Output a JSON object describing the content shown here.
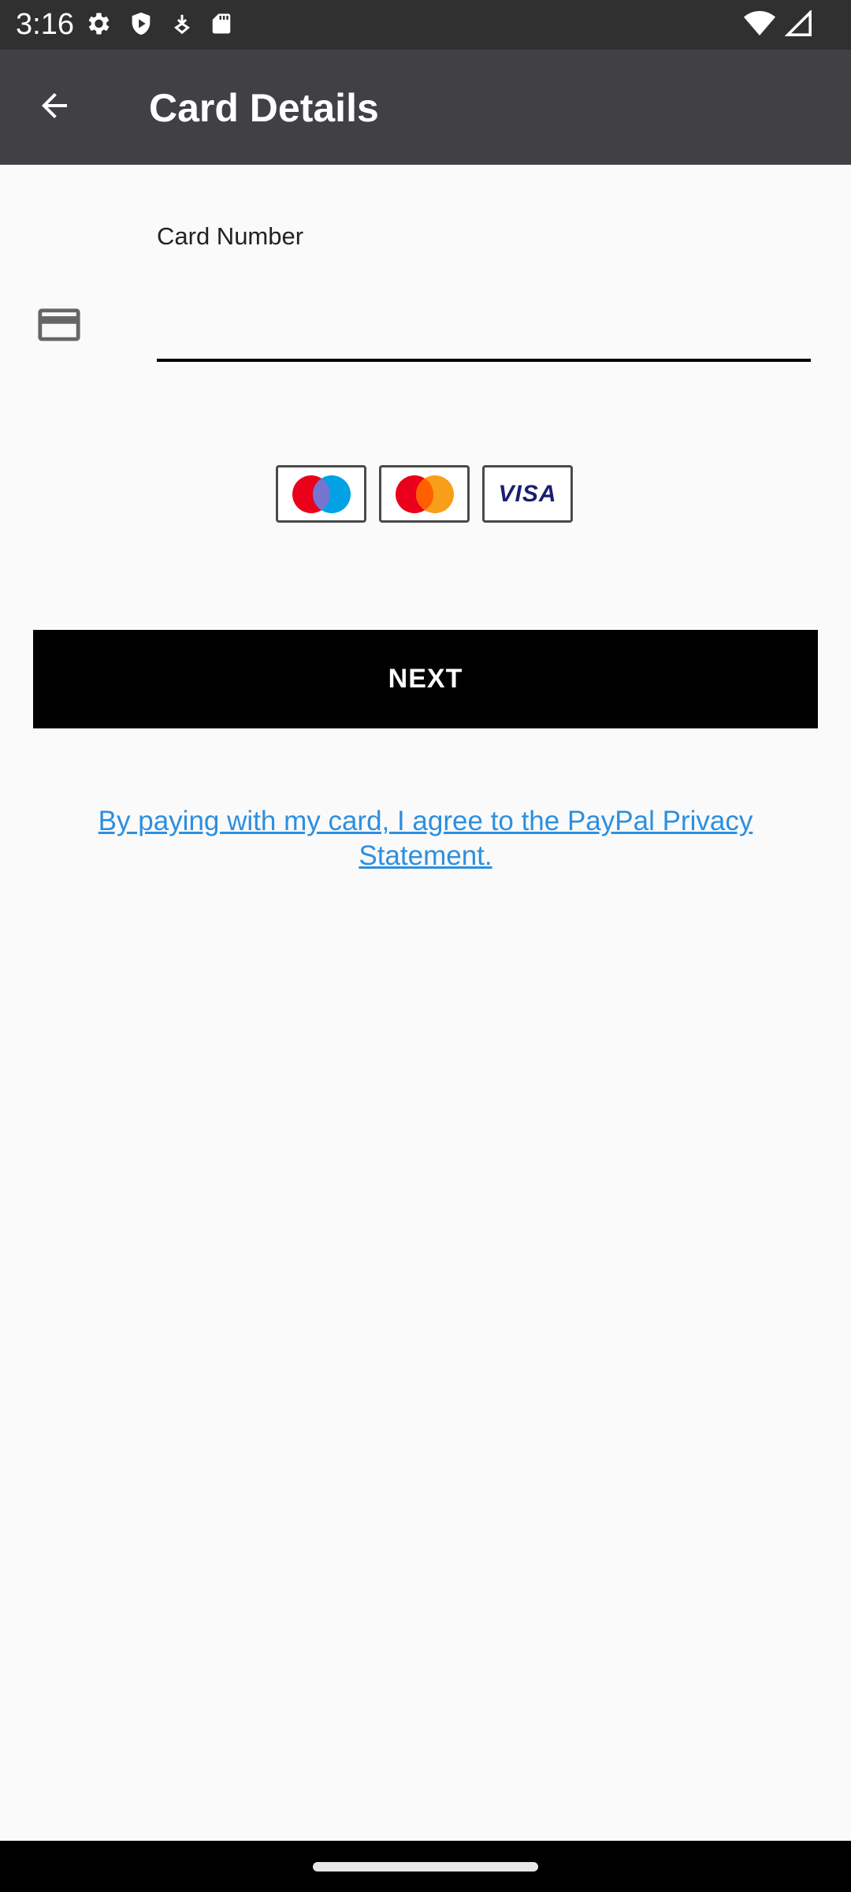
{
  "status_bar": {
    "time": "3:16",
    "left_icons": [
      "settings-icon",
      "shield-icon",
      "download-icon",
      "sd-card-icon"
    ],
    "right_icons": [
      "wifi-icon",
      "signal-icon"
    ]
  },
  "app_bar": {
    "title": "Card Details",
    "back_icon": "arrow-back-icon",
    "background": "#414045"
  },
  "card_form": {
    "label": "Card Number",
    "value": "",
    "icon": "credit-card-icon",
    "accepted_cards": [
      "Maestro",
      "Mastercard",
      "Visa"
    ],
    "visa_logo_text": "VISA"
  },
  "next_button": {
    "label": "NEXT",
    "background": "#000000"
  },
  "privacy": {
    "link_text": "By paying with my card, I agree to the PayPal Privacy Statement.",
    "color": "#2d8fe0"
  }
}
